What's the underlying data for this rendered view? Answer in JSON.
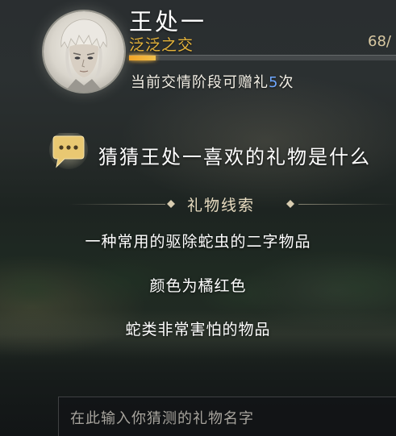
{
  "npc": {
    "name": "王处一",
    "relation_tier": "泛泛之交",
    "friendship_value": "68/",
    "friendship_progress_fraction": 0.1,
    "avatar_icon": "npc-portrait-icon"
  },
  "gift_status": {
    "prefix": "当前交情阶段可赠礼",
    "count": "5",
    "suffix": "次"
  },
  "question": {
    "icon": "chat-bubble-icon",
    "text": "猜猜王处一喜欢的礼物是什么"
  },
  "clues": {
    "title": "礼物线索",
    "items": [
      "一种常用的驱除蛇虫的二字物品",
      "颜色为橘红色",
      "蛇类非常害怕的物品"
    ]
  },
  "guess_input": {
    "placeholder": "在此输入你猜测的礼物名字",
    "value": ""
  },
  "colors": {
    "relation_text": "#e6b43a",
    "progress_fill": "#f3a427",
    "count_highlight": "#6fa8ff",
    "chat_icon": "#e9c872"
  }
}
